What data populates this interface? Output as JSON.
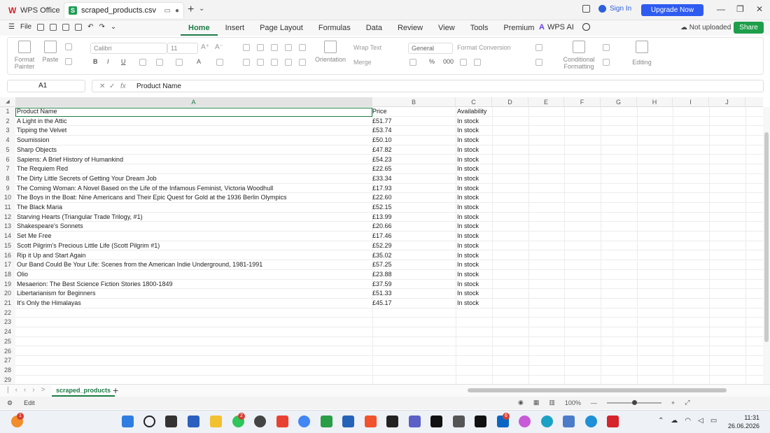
{
  "titlebar": {
    "home_label": "WPS Office",
    "doc_tab": "scraped_products.csv",
    "signin": "Sign In",
    "upgrade": "Upgrade Now"
  },
  "menubar": {
    "file": "File",
    "tabs": [
      "Home",
      "Insert",
      "Page Layout",
      "Formulas",
      "Data",
      "Review",
      "View",
      "Tools",
      "Premium"
    ],
    "wps_ai": "WPS AI",
    "not_uploaded": "Not uploaded",
    "share": "Share"
  },
  "ribbon": {
    "format_painter": "Format Painter",
    "paste": "Paste",
    "font": "Calibri",
    "size": "11",
    "wrap_text": "Wrap Text",
    "orientation": "Orientation",
    "merge": "Merge",
    "number_format": "General",
    "format_conversion": "Format Conversion",
    "conditional_formatting": "Conditional Formatting",
    "editing": "Editing"
  },
  "formula_bar": {
    "cell_ref": "A1",
    "fx": "fx",
    "value": "Product Name"
  },
  "sheet": {
    "columns": [
      "A",
      "B",
      "C",
      "D",
      "E",
      "F",
      "G",
      "H",
      "I",
      "J"
    ],
    "row_numbers": [
      "1",
      "2",
      "3",
      "4",
      "5",
      "6",
      "7",
      "8",
      "9",
      "10",
      "11",
      "12",
      "13",
      "14",
      "15",
      "16",
      "17",
      "18",
      "19",
      "20",
      "21",
      "22",
      "23",
      "24",
      "25",
      "26",
      "27",
      "28",
      "29"
    ],
    "rows": [
      [
        "Product Name",
        "Price",
        "Availability"
      ],
      [
        "A Light in the Attic",
        "£51.77",
        "In stock"
      ],
      [
        "Tipping the Velvet",
        "£53.74",
        "In stock"
      ],
      [
        "Soumission",
        "£50.10",
        "In stock"
      ],
      [
        "Sharp Objects",
        "£47.82",
        "In stock"
      ],
      [
        "Sapiens: A Brief History of Humankind",
        "£54.23",
        "In stock"
      ],
      [
        "The Requiem Red",
        "£22.65",
        "In stock"
      ],
      [
        "The Dirty Little Secrets of Getting Your Dream Job",
        "£33.34",
        "In stock"
      ],
      [
        "The Coming Woman: A Novel Based on the Life of the Infamous Feminist, Victoria Woodhull",
        "£17.93",
        "In stock"
      ],
      [
        "The Boys in the Boat: Nine Americans and Their Epic Quest for Gold at the 1936 Berlin Olympics",
        "£22.60",
        "In stock"
      ],
      [
        "The Black Maria",
        "£52.15",
        "In stock"
      ],
      [
        "Starving Hearts (Triangular Trade Trilogy, #1)",
        "£13.99",
        "In stock"
      ],
      [
        "Shakespeare's Sonnets",
        "£20.66",
        "In stock"
      ],
      [
        "Set Me Free",
        "£17.46",
        "In stock"
      ],
      [
        "Scott Pilgrim's Precious Little Life (Scott Pilgrim #1)",
        "£52.29",
        "In stock"
      ],
      [
        "Rip it Up and Start Again",
        "£35.02",
        "In stock"
      ],
      [
        "Our Band Could Be Your Life: Scenes from the American Indie Underground, 1981-1991",
        "£57.25",
        "In stock"
      ],
      [
        "Olio",
        "£23.88",
        "In stock"
      ],
      [
        "Mesaerion: The Best Science Fiction Stories 1800-1849",
        "£37.59",
        "In stock"
      ],
      [
        "Libertarianism for Beginners",
        "£51.33",
        "In stock"
      ],
      [
        "It's Only the Himalayas",
        "£45.17",
        "In stock"
      ]
    ],
    "sheet_tab": "scraped_products"
  },
  "statusbar": {
    "mode": "Edit",
    "zoom": "100%"
  },
  "taskbar": {
    "time": "11:31",
    "date": "26.06.2026"
  },
  "colors": {
    "accent_green": "#1e7b45",
    "upgrade_blue": "#2e5bf0"
  }
}
